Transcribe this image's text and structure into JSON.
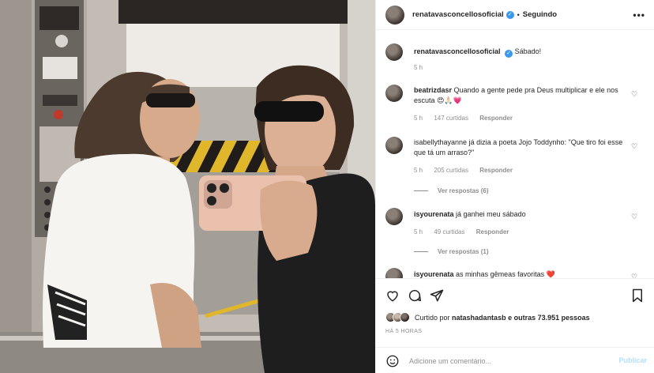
{
  "header": {
    "username": "renatavasconcellosoficial",
    "separator": "•",
    "follow_status": "Seguindo",
    "more_icon": "more-horizontal-icon"
  },
  "caption": {
    "username": "renatavasconcellosoficial",
    "text": "Sábado!",
    "time": "5 h"
  },
  "comments": [
    {
      "username": "beatrizdasr",
      "text": "Quando a gente pede pra Deus multiplicar e ele nos escuta 😍🙏🏻💗",
      "time": "5 h",
      "likes": "147 curtidas",
      "reply": "Responder",
      "view_replies": ""
    },
    {
      "username": "isabellythayanne",
      "text": "já dizia a poeta Jojo Toddynho: \"Que tiro foi esse que tá um arraso?\"",
      "time": "5 h",
      "likes": "205 curtidas",
      "reply": "Responder",
      "view_replies": "Ver respostas (6)"
    },
    {
      "username": "isyourenata",
      "text": "já ganhei meu sábado",
      "time": "5 h",
      "likes": "49 curtidas",
      "reply": "Responder",
      "view_replies": "Ver respostas (1)"
    },
    {
      "username": "isyourenata",
      "text": "as minhas gêmeas favoritas ❤️",
      "time": "",
      "likes": "",
      "reply": "",
      "view_replies": ""
    }
  ],
  "actions": {
    "liked_prefix": "Curtido por",
    "liked_user": "natashadantasb",
    "liked_suffix": "e outras",
    "liked_count": "73.951 pessoas",
    "timestamp": "HÁ 5 HORAS"
  },
  "comment_box": {
    "placeholder": "Adicione um comentário...",
    "publish": "Publicar"
  },
  "colors": {
    "verified": "#3897f0",
    "publish_disabled": "#b2dffc",
    "heart_red": "#ed4956"
  }
}
